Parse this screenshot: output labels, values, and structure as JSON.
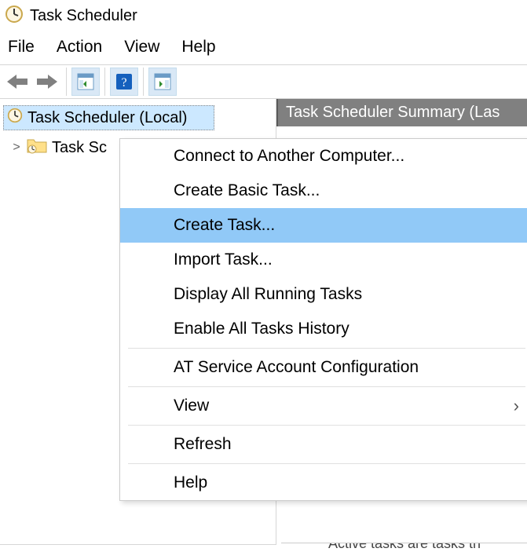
{
  "window": {
    "title": "Task Scheduler"
  },
  "menubar": {
    "file": "File",
    "action": "Action",
    "view": "View",
    "help": "Help"
  },
  "tree": {
    "root_label": "Task Scheduler (Local)",
    "child_label": "Task Sc"
  },
  "summary": {
    "header": "Task Scheduler Summary (Las",
    "bottom_slice": "Active tasks are tasks th"
  },
  "context_menu": {
    "items": {
      "connect": "Connect to Another Computer...",
      "create_basic": "Create Basic Task...",
      "create_task": "Create Task...",
      "import_task": "Import Task...",
      "display_all": "Display All Running Tasks",
      "enable_hist": "Enable All Tasks History",
      "at_config": "AT Service Account Configuration",
      "view": "View",
      "refresh": "Refresh",
      "help": "Help"
    }
  }
}
